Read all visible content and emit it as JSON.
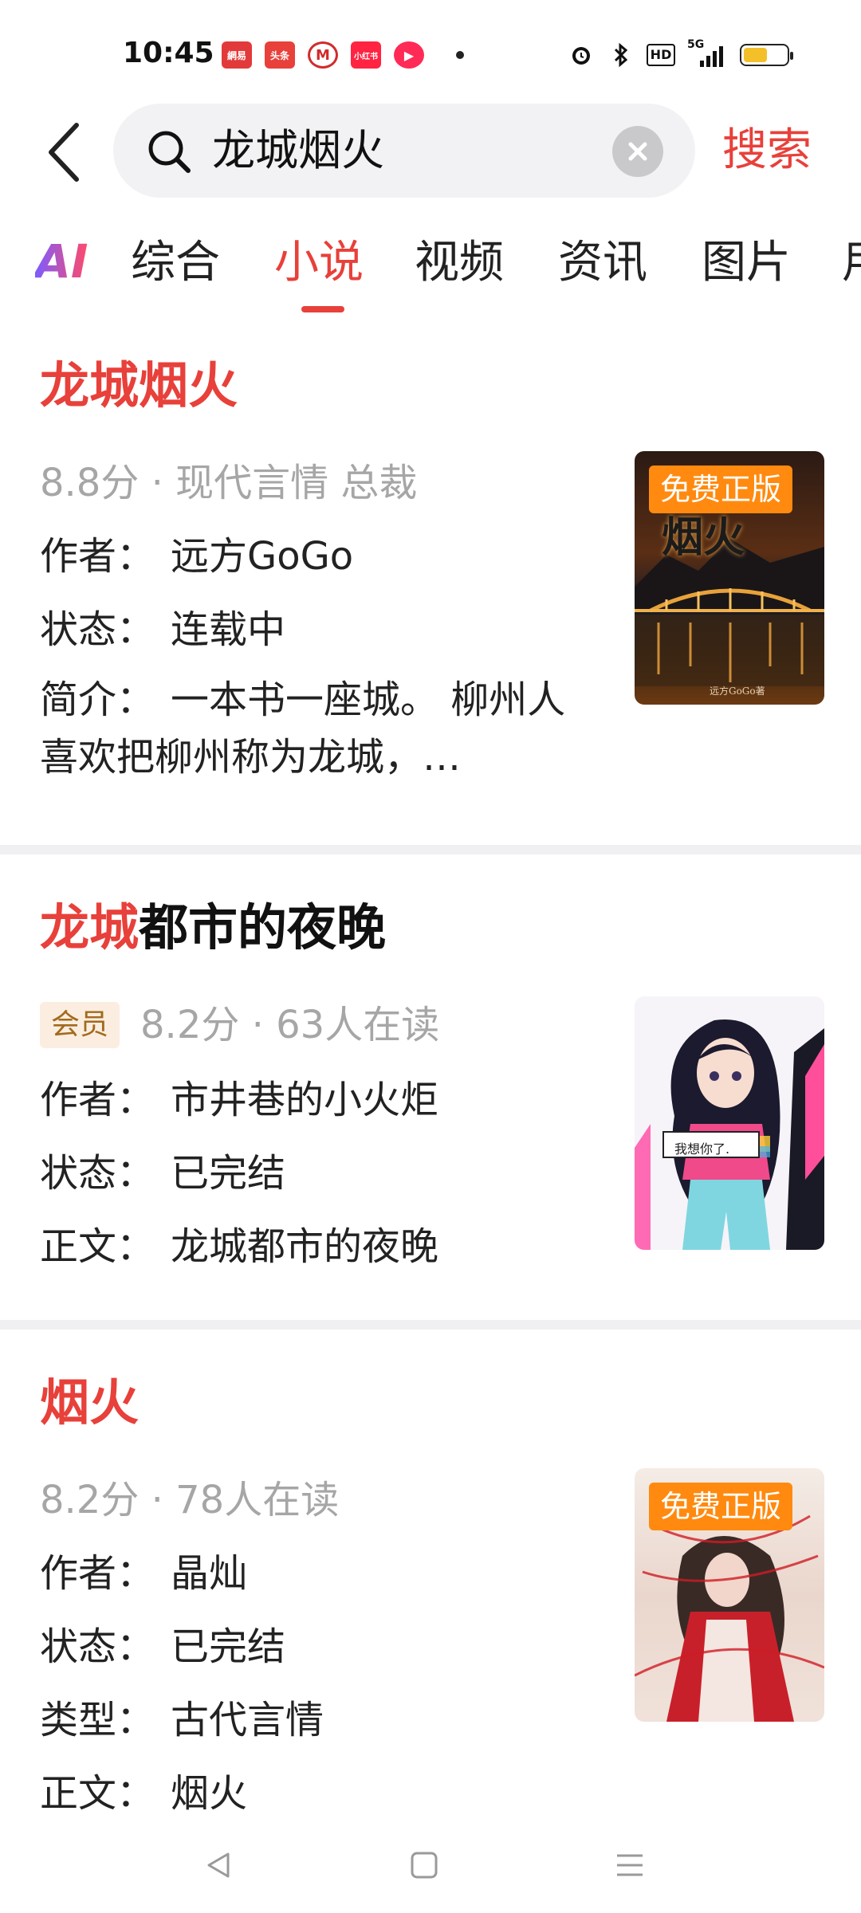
{
  "status_bar": {
    "time": "10:45",
    "notification_icons": [
      {
        "name": "netease-news-icon",
        "label": "網易",
        "color": "#e23a3a"
      },
      {
        "name": "toutiao-icon",
        "label": "头条",
        "color": "#e8403a"
      },
      {
        "name": "cmb-bank-icon",
        "label": "M",
        "color": "#d12b2b"
      },
      {
        "name": "xiaohongshu-icon",
        "label": "小红书",
        "color": "#ff2442"
      },
      {
        "name": "video-app-icon",
        "label": "▶",
        "color": "#ff2a55"
      }
    ],
    "network_label": "5G",
    "hd_label": "HD",
    "battery_level": 0.55
  },
  "search": {
    "query": "龙城烟火",
    "submit_label": "搜索"
  },
  "tabs": {
    "ai_label": "AI",
    "items": [
      "综合",
      "小说",
      "视频",
      "资讯",
      "图片",
      "用"
    ],
    "active_index": 1
  },
  "results": [
    {
      "title_highlight": "龙城烟火",
      "title_rest": "",
      "meta": "8.8分 · 现代言情 总裁",
      "badge": "",
      "free_badge": "免费正版",
      "rows": [
        {
          "label": "作者：",
          "value": "远方GoGo"
        },
        {
          "label": "状态：",
          "value": "连载中"
        }
      ],
      "desc_label": "简介：",
      "desc": "一本书一座城。 柳州人喜欢把柳州称为龙城，…"
    },
    {
      "title_highlight": "龙城",
      "title_rest": "都市的夜晚",
      "meta": "8.2分 · 63人在读",
      "badge": "会员",
      "free_badge": "",
      "cover_caption": "我想你了.",
      "rows": [
        {
          "label": "作者：",
          "value": "市井巷的小火炬"
        },
        {
          "label": "状态：",
          "value": "已完结"
        },
        {
          "label": "正文：",
          "value": "龙城都市的夜晚"
        }
      ]
    },
    {
      "title_highlight": "烟火",
      "title_rest": "",
      "meta": "8.2分 · 78人在读",
      "badge": "",
      "free_badge": "免费正版",
      "rows": [
        {
          "label": "作者：",
          "value": "晶灿"
        },
        {
          "label": "状态：",
          "value": "已完结"
        },
        {
          "label": "类型：",
          "value": "古代言情"
        },
        {
          "label": "正文：",
          "value": "烟火"
        }
      ]
    }
  ],
  "cover_texts": {
    "book1_title": "烟火",
    "book1_author": "远方GoGo著"
  }
}
